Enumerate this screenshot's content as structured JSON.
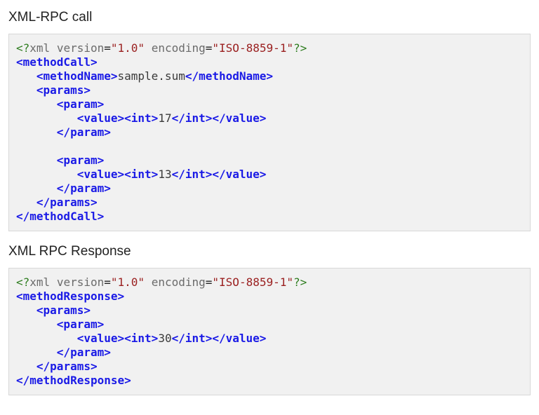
{
  "sections": {
    "call_title": "XML-RPC call",
    "response_title": "XML RPC Response"
  },
  "xml_decl": {
    "pi_open": "<?",
    "kw_xml": "xml",
    "attr_version": "version",
    "val_version": "\"1.0\"",
    "attr_encoding": "encoding",
    "val_encoding": "\"ISO-8859-1\"",
    "pi_close": "?>"
  },
  "tags": {
    "methodCall_open": "<methodCall>",
    "methodCall_close": "</methodCall>",
    "methodName_open": "<methodName>",
    "methodName_close": "</methodName>",
    "params_open": "<params>",
    "params_close": "</params>",
    "param_open": "<param>",
    "param_close": "</param>",
    "value_open": "<value>",
    "value_close": "</value>",
    "int_open": "<int>",
    "int_close": "</int>",
    "methodResponse_open": "<methodResponse>",
    "methodResponse_close": "</methodResponse>"
  },
  "values": {
    "method_name": "sample.sum",
    "int1": "17",
    "int2": "13",
    "result": "30"
  },
  "punct": {
    "eq": "=",
    "sp": " "
  }
}
